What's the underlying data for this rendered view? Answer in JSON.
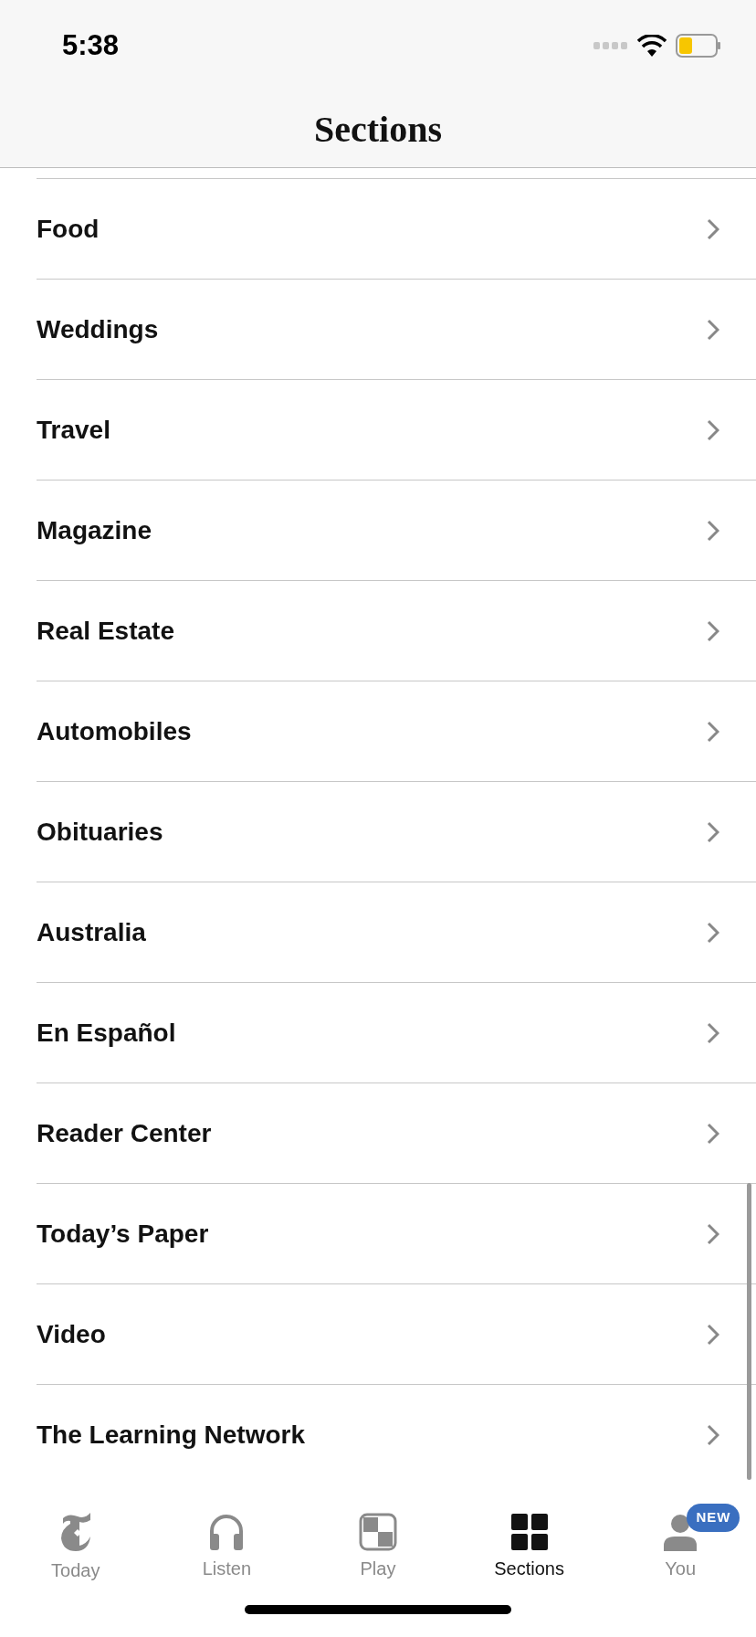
{
  "status_bar": {
    "time": "5:38"
  },
  "header": {
    "title": "Sections"
  },
  "sections": [
    {
      "label": "Food"
    },
    {
      "label": "Weddings"
    },
    {
      "label": "Travel"
    },
    {
      "label": "Magazine"
    },
    {
      "label": "Real Estate"
    },
    {
      "label": "Automobiles"
    },
    {
      "label": "Obituaries"
    },
    {
      "label": "Australia"
    },
    {
      "label": "En Español"
    },
    {
      "label": "Reader Center"
    },
    {
      "label": "Today’s Paper"
    },
    {
      "label": "Video"
    },
    {
      "label": "The Learning Network"
    }
  ],
  "tab_bar": [
    {
      "kind": "today",
      "label": "Today",
      "selected": false
    },
    {
      "kind": "listen",
      "label": "Listen",
      "selected": false
    },
    {
      "kind": "play",
      "label": "Play",
      "selected": false
    },
    {
      "kind": "sections",
      "label": "Sections",
      "selected": true
    },
    {
      "kind": "you",
      "label": "You",
      "selected": false,
      "badge": "NEW"
    }
  ]
}
